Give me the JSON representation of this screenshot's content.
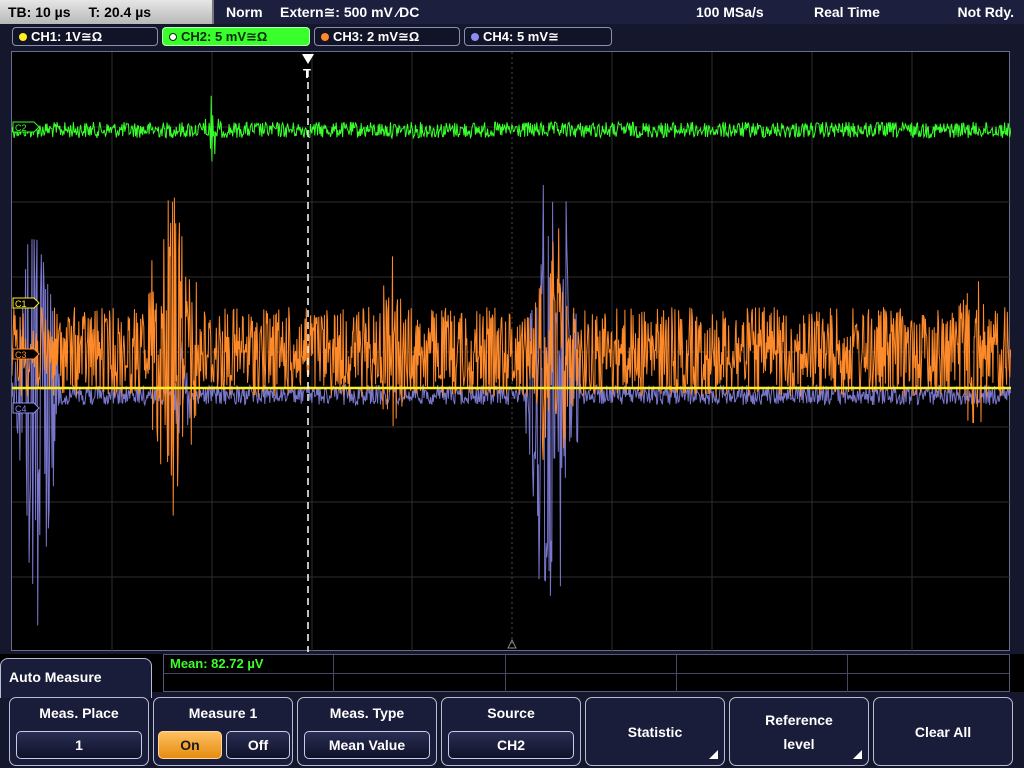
{
  "topbar": {
    "timebase": "TB: 10 µs",
    "trigger_time": "T: 20.4 µs",
    "mode": "Norm",
    "trigger": "Extern≅: 500 mV ⁄DC",
    "sample_rate": "100 MSa/s",
    "acquisition": "Real Time",
    "status": "Not Rdy."
  },
  "channels": [
    {
      "label": "CH1: 1V≅Ω",
      "color": "#ffee22",
      "active": false
    },
    {
      "label": "CH2: 5 mV≅Ω",
      "color": "#39ff2c",
      "active": true
    },
    {
      "label": "CH3: 2 mV≅Ω",
      "color": "#ff8a2a",
      "active": false
    },
    {
      "label": "CH4: 5 mV≅",
      "color": "#8e8cf0",
      "active": false
    }
  ],
  "markers": {
    "c1": "C1",
    "c2": "C2",
    "c3": "C3",
    "c4": "C4",
    "trigger": "T"
  },
  "measurement": {
    "result": "Mean: 82.72 µV"
  },
  "menu": {
    "title": "Auto Measure",
    "meas_place_title": "Meas. Place",
    "meas_place_value": "1",
    "measure1_title": "Measure 1",
    "measure1_on": "On",
    "measure1_off": "Off",
    "meas_type_title": "Meas. Type",
    "meas_type_value": "Mean Value",
    "source_title": "Source",
    "source_value": "CH2",
    "statistic_label": "Statistic",
    "reference_line1": "Reference",
    "reference_line2": "level",
    "clear_all_label": "Clear All"
  },
  "colors": {
    "ch1": "#ffee22",
    "ch2": "#39ff2c",
    "ch3": "#ff8a2a",
    "ch4": "#8e8cf0",
    "grid": "#3a3a3a",
    "active_toggle": "#f0a030"
  }
}
